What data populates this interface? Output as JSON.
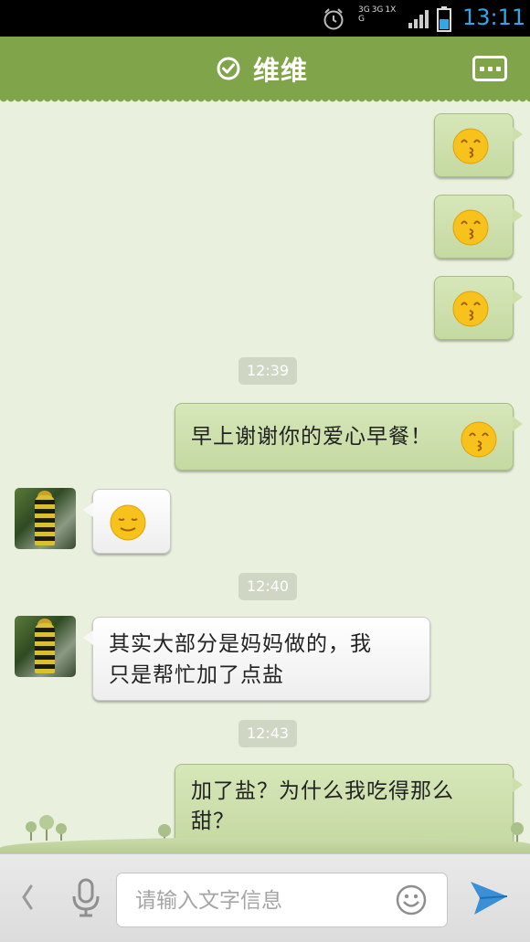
{
  "status_bar": {
    "network_labels": [
      "3G",
      "3G",
      "1X",
      "G"
    ],
    "time": "13:11",
    "icons": [
      "alarm-icon",
      "signal-icon",
      "battery-icon"
    ]
  },
  "header": {
    "title": "维维",
    "icons": [
      "verified-check-icon",
      "more-menu-icon"
    ]
  },
  "messages": [
    {
      "side": "me",
      "type": "emoji",
      "emoji": "kiss-emoji"
    },
    {
      "side": "me",
      "type": "emoji",
      "emoji": "kiss-emoji"
    },
    {
      "side": "me",
      "type": "emoji",
      "emoji": "kiss-emoji"
    },
    {
      "type": "timestamp",
      "text": "12:39"
    },
    {
      "side": "me",
      "type": "text",
      "text": "早上谢谢你的爱心早餐！",
      "emoji": "kiss-emoji"
    },
    {
      "side": "them",
      "type": "emoji",
      "emoji": "content-smile-emoji"
    },
    {
      "type": "timestamp",
      "text": "12:40"
    },
    {
      "side": "them",
      "type": "text",
      "lines": [
        "其实大部分是妈妈做的，我",
        "只是帮忙加了点盐"
      ]
    },
    {
      "type": "timestamp",
      "text": "12:43"
    },
    {
      "side": "me",
      "type": "text",
      "lines": [
        "加了盐？为什么我吃得那么",
        "甜？"
      ]
    }
  ],
  "input_bar": {
    "placeholder": "请输入文字信息",
    "value": "",
    "icons": [
      "back-chevron-icon",
      "microphone-icon",
      "smiley-icon",
      "send-icon"
    ]
  },
  "colors": {
    "header_green": "#7fa44a",
    "chat_background": "#e9f0dd",
    "my_bubble": "#d0e2b0",
    "their_bubble": "#f5f5f5",
    "time_accent": "#2fa7e8",
    "send_blue": "#3b8fd6"
  }
}
